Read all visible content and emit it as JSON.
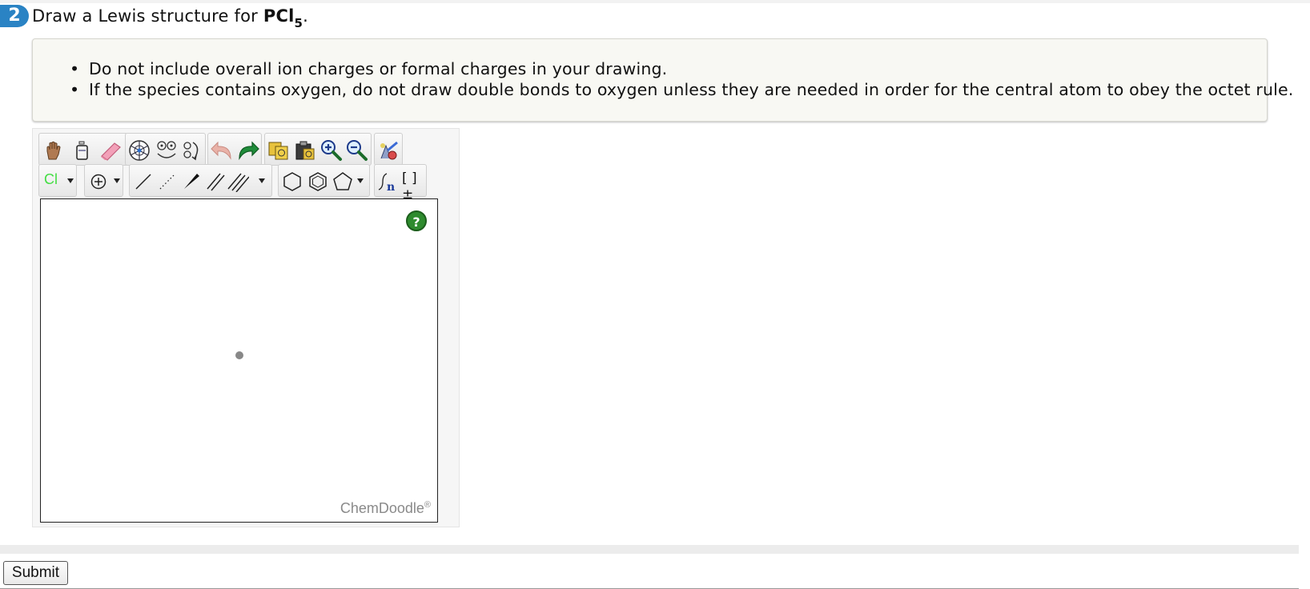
{
  "question": {
    "number": "2",
    "prompt_prefix": "Draw a Lewis structure for ",
    "formula_main": "PCl",
    "formula_sub": "5",
    "prompt_suffix": "."
  },
  "instructions": [
    "Do not include overall ion charges or formal charges in your drawing.",
    "If the species contains oxygen, do not draw double bonds to oxygen unless they are needed in order for the central atom to obey the octet rule."
  ],
  "editor": {
    "element_label": "Cl",
    "element_color": "#44dd44",
    "help_label": "?",
    "brand": "ChemDoodle",
    "brand_mark": "®",
    "bracket_label": "[ ]±"
  },
  "submit_label": "Submit"
}
